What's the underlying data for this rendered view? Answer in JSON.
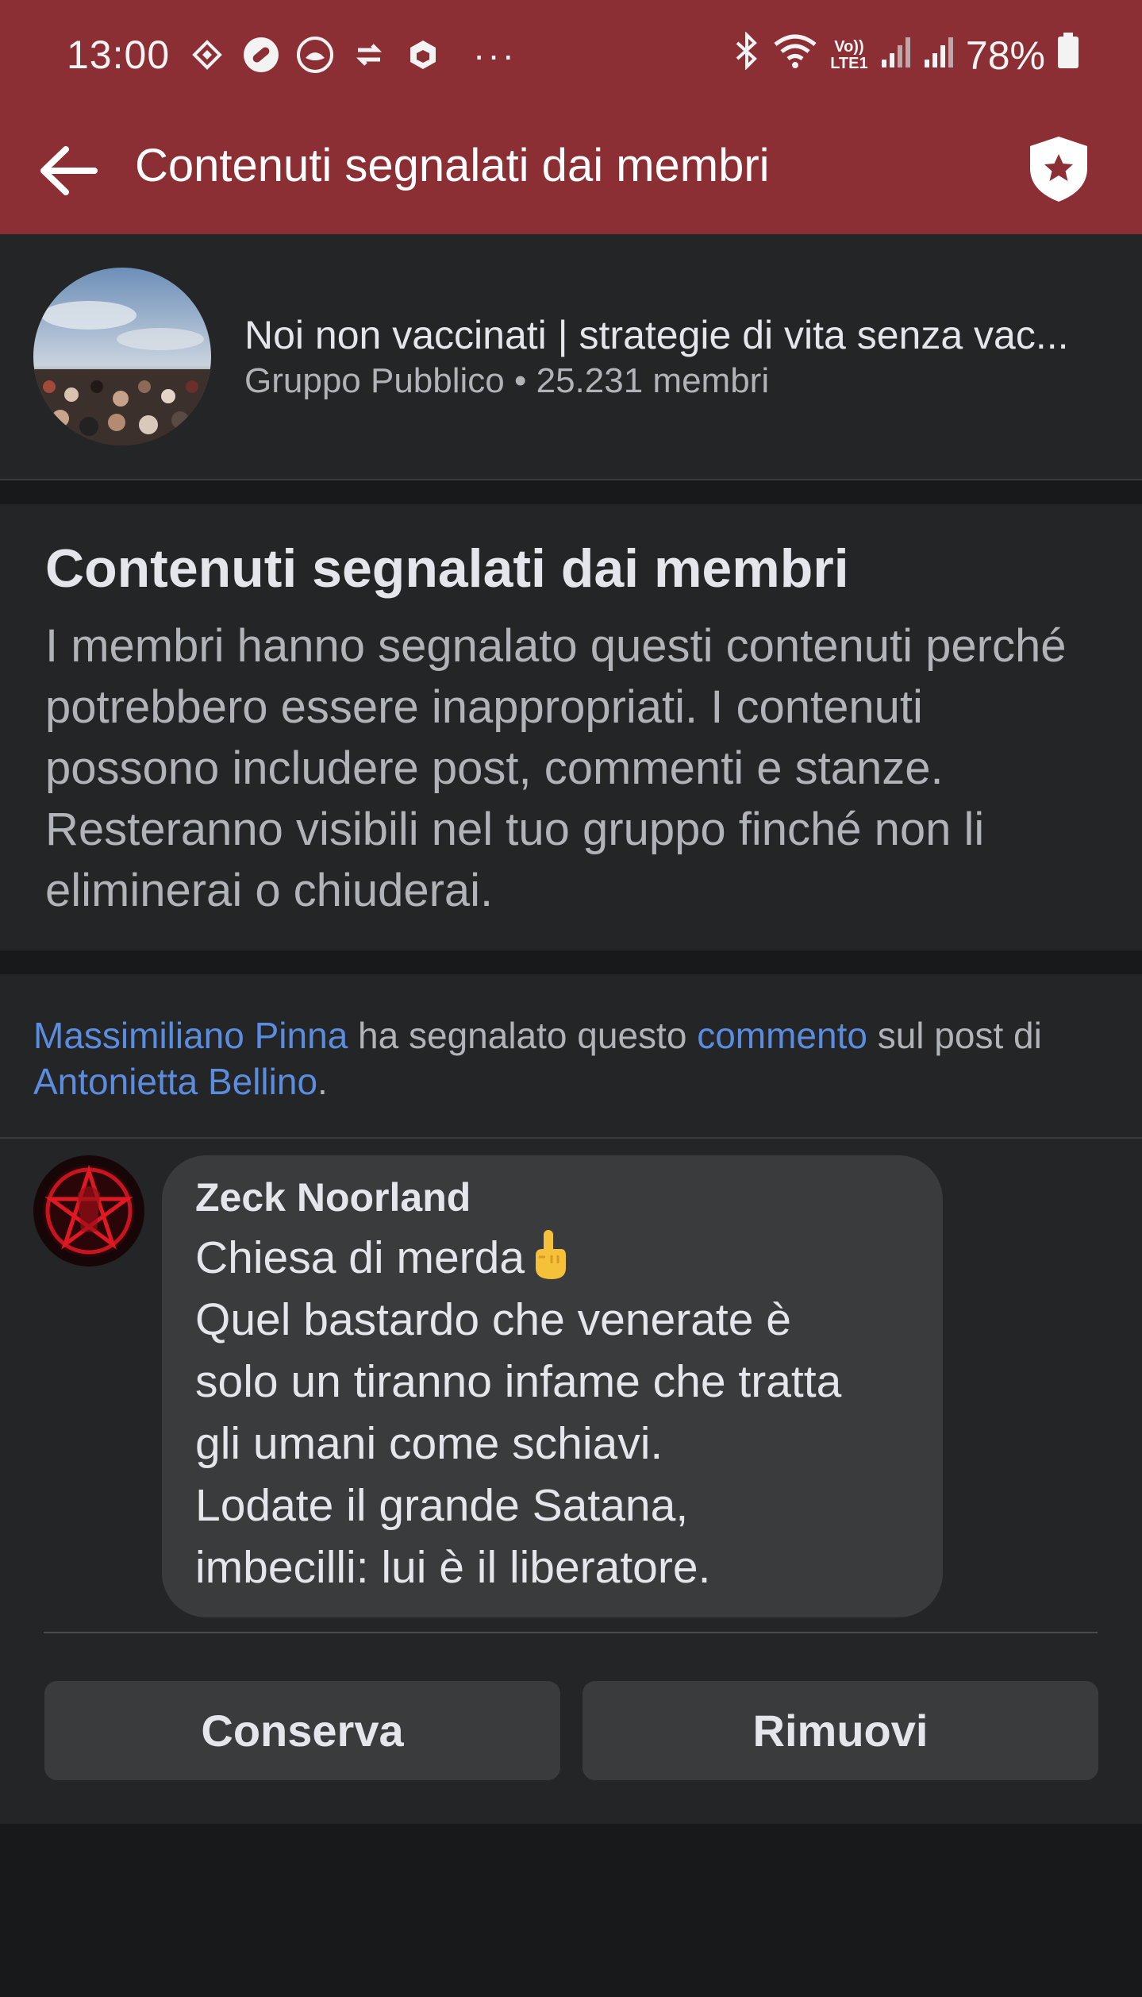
{
  "status_bar": {
    "time": "13:00",
    "battery": "78%",
    "left_icons": [
      "badge-icon",
      "pill-icon",
      "lotus-icon",
      "sync-icon",
      "box-icon"
    ],
    "more": "···",
    "right_icons": [
      "bluetooth-icon",
      "wifi-icon",
      "volte-icon",
      "signal-icon",
      "signal-icon",
      "battery-icon"
    ],
    "volte_text": "Vo)) LTE1"
  },
  "app_bar": {
    "title": "Contenuti segnalati dai membri",
    "back_icon": "arrow-left-icon",
    "action_icon": "shield-star-icon"
  },
  "group": {
    "name": "Noi non vaccinati | strategie di vita senza vac...",
    "meta": "Gruppo Pubblico • 25.231 membri"
  },
  "info": {
    "title": "Contenuti segnalati dai membri",
    "description": "I membri hanno segnalato questi contenuti perché potrebbero essere inappropriati. I contenuti possono includere post, commenti e stanze. Resteranno visibili nel tuo gruppo finché non li eliminerai o chiuderai."
  },
  "report": {
    "reporter": "Massimiliano Pinna",
    "text1": " ha segnalato questo ",
    "item_link": "commento",
    "text2": " sul post di ",
    "post_author": "Antonietta Bellino",
    "text3": "."
  },
  "comment": {
    "author": "Zeck Noorland",
    "lines": [
      "Chiesa di merda",
      "Quel bastardo che venerate è",
      "solo un tiranno infame che tratta",
      "gli umani come schiavi.",
      "Lodate il grande Satana,",
      "imbecilli: lui è il liberatore."
    ],
    "emoji": "middle-finger-emoji"
  },
  "actions": {
    "keep": "Conserva",
    "remove": "Rimuovi"
  },
  "colors": {
    "header": "#8c2f35",
    "card": "#242526",
    "background": "#18191a",
    "bubble": "#3a3b3c",
    "link": "#5b8cdd"
  }
}
